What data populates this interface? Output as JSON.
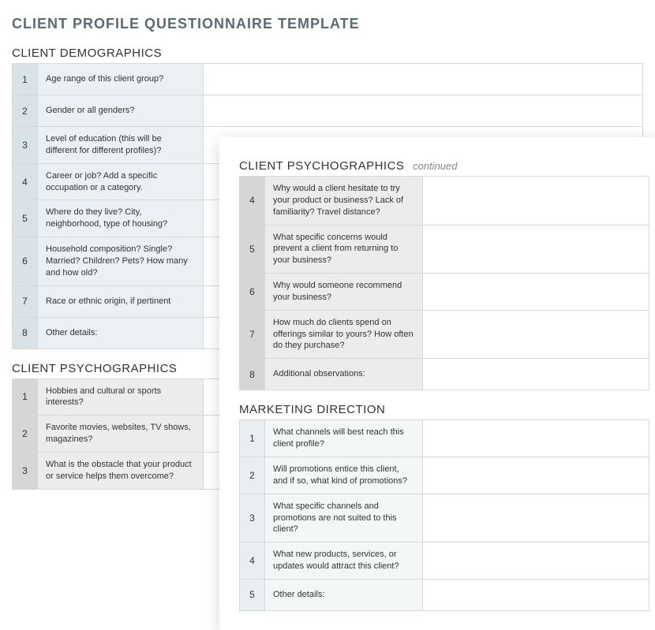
{
  "main_title": "CLIENT PROFILE QUESTIONNAIRE TEMPLATE",
  "sections": {
    "demographics": {
      "title": "CLIENT DEMOGRAPHICS",
      "rows": [
        {
          "num": "1",
          "q": "Age range of this client group?"
        },
        {
          "num": "2",
          "q": "Gender or all genders?"
        },
        {
          "num": "3",
          "q": "Level of education (this will be different for different profiles)?"
        },
        {
          "num": "4",
          "q": "Career or job? Add a specific occupation or a category."
        },
        {
          "num": "5",
          "q": "Where do they live? City, neighborhood, type of housing?"
        },
        {
          "num": "6",
          "q": "Household composition? Single? Married? Children? Pets? How many and how old?"
        },
        {
          "num": "7",
          "q": "Race or ethnic origin, if pertinent"
        },
        {
          "num": "8",
          "q": "Other details:"
        }
      ]
    },
    "psychographics1": {
      "title": "CLIENT PSYCHOGRAPHICS",
      "rows": [
        {
          "num": "1",
          "q": "Hobbies and cultural or sports interests?"
        },
        {
          "num": "2",
          "q": "Favorite movies, websites, TV shows, magazines?"
        },
        {
          "num": "3",
          "q": "What is the obstacle that your product or service helps them overcome?"
        }
      ]
    },
    "psychographics2": {
      "title": "CLIENT PSYCHOGRAPHICS",
      "continued": "continued",
      "rows": [
        {
          "num": "4",
          "q": "Why would a client hesitate to try your product or business? Lack of familiarity? Travel distance?"
        },
        {
          "num": "5",
          "q": "What specific concerns would prevent a client from returning to your business?"
        },
        {
          "num": "6",
          "q": "Why would someone recommend your business?"
        },
        {
          "num": "7",
          "q": "How much do clients spend on offerings similar to yours? How often do they purchase?"
        },
        {
          "num": "8",
          "q": "Additional observations:"
        }
      ]
    },
    "marketing": {
      "title": "MARKETING DIRECTION",
      "rows": [
        {
          "num": "1",
          "q": "What channels will best reach this client profile?"
        },
        {
          "num": "2",
          "q": "Will promotions entice this client, and if so, what kind of promotions?"
        },
        {
          "num": "3",
          "q": "What specific channels and promotions are not suited to this client?"
        },
        {
          "num": "4",
          "q": "What new products, services, or updates would attract this client?"
        },
        {
          "num": "5",
          "q": "Other details:"
        }
      ]
    }
  }
}
